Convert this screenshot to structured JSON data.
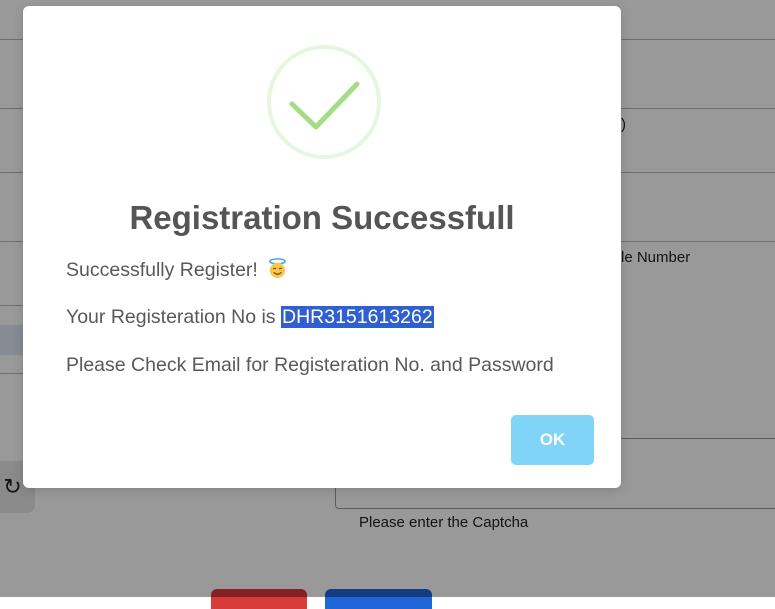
{
  "background_form": {
    "partial_label_1": ")",
    "partial_label_2": "le Number",
    "captcha_hint": "Please enter the Captcha",
    "refresh_icon": "refresh-icon"
  },
  "modal": {
    "icon": "check-circle-icon",
    "title": "Registration Successfull",
    "line1": "Successfully Register!",
    "line1_emoji": "smiling-face-with-halo-icon",
    "line2_prefix": "Your Registeration No is ",
    "registration_no": "DHR3151613262",
    "line3": "Please Check Email for Registeration No. and Password",
    "ok_label": "OK"
  },
  "colors": {
    "ok_button": "#7fd4f8",
    "check": "#a5dc86",
    "selection": "#2f5fd0",
    "cancel_button": "#d93a3a",
    "submit_button": "#1f66d6"
  }
}
